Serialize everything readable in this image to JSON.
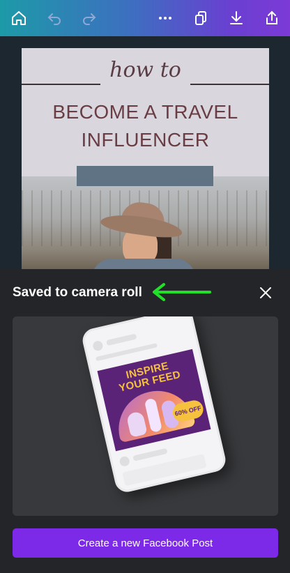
{
  "toolbar": {
    "icons": [
      "home-icon",
      "undo-icon",
      "redo-icon",
      "more-icon",
      "copy-icon",
      "download-icon",
      "share-icon"
    ],
    "accent_gradient": [
      "#1d9aa8",
      "#7c3ad6"
    ]
  },
  "design": {
    "script_text": "how to",
    "headline_line1": "BECOME A TRAVEL",
    "headline_line2": "INFLUENCER"
  },
  "sheet": {
    "title": "Saved to camera roll",
    "annotation_arrow_color": "#22e02a",
    "preview": {
      "ad_title_line1": "INSPIRE",
      "ad_title_line2": "YOUR FEED",
      "ad_badge": "60% OFF"
    },
    "cta_label": "Create a new Facebook Post",
    "cta_color": "#7d2ae8"
  }
}
